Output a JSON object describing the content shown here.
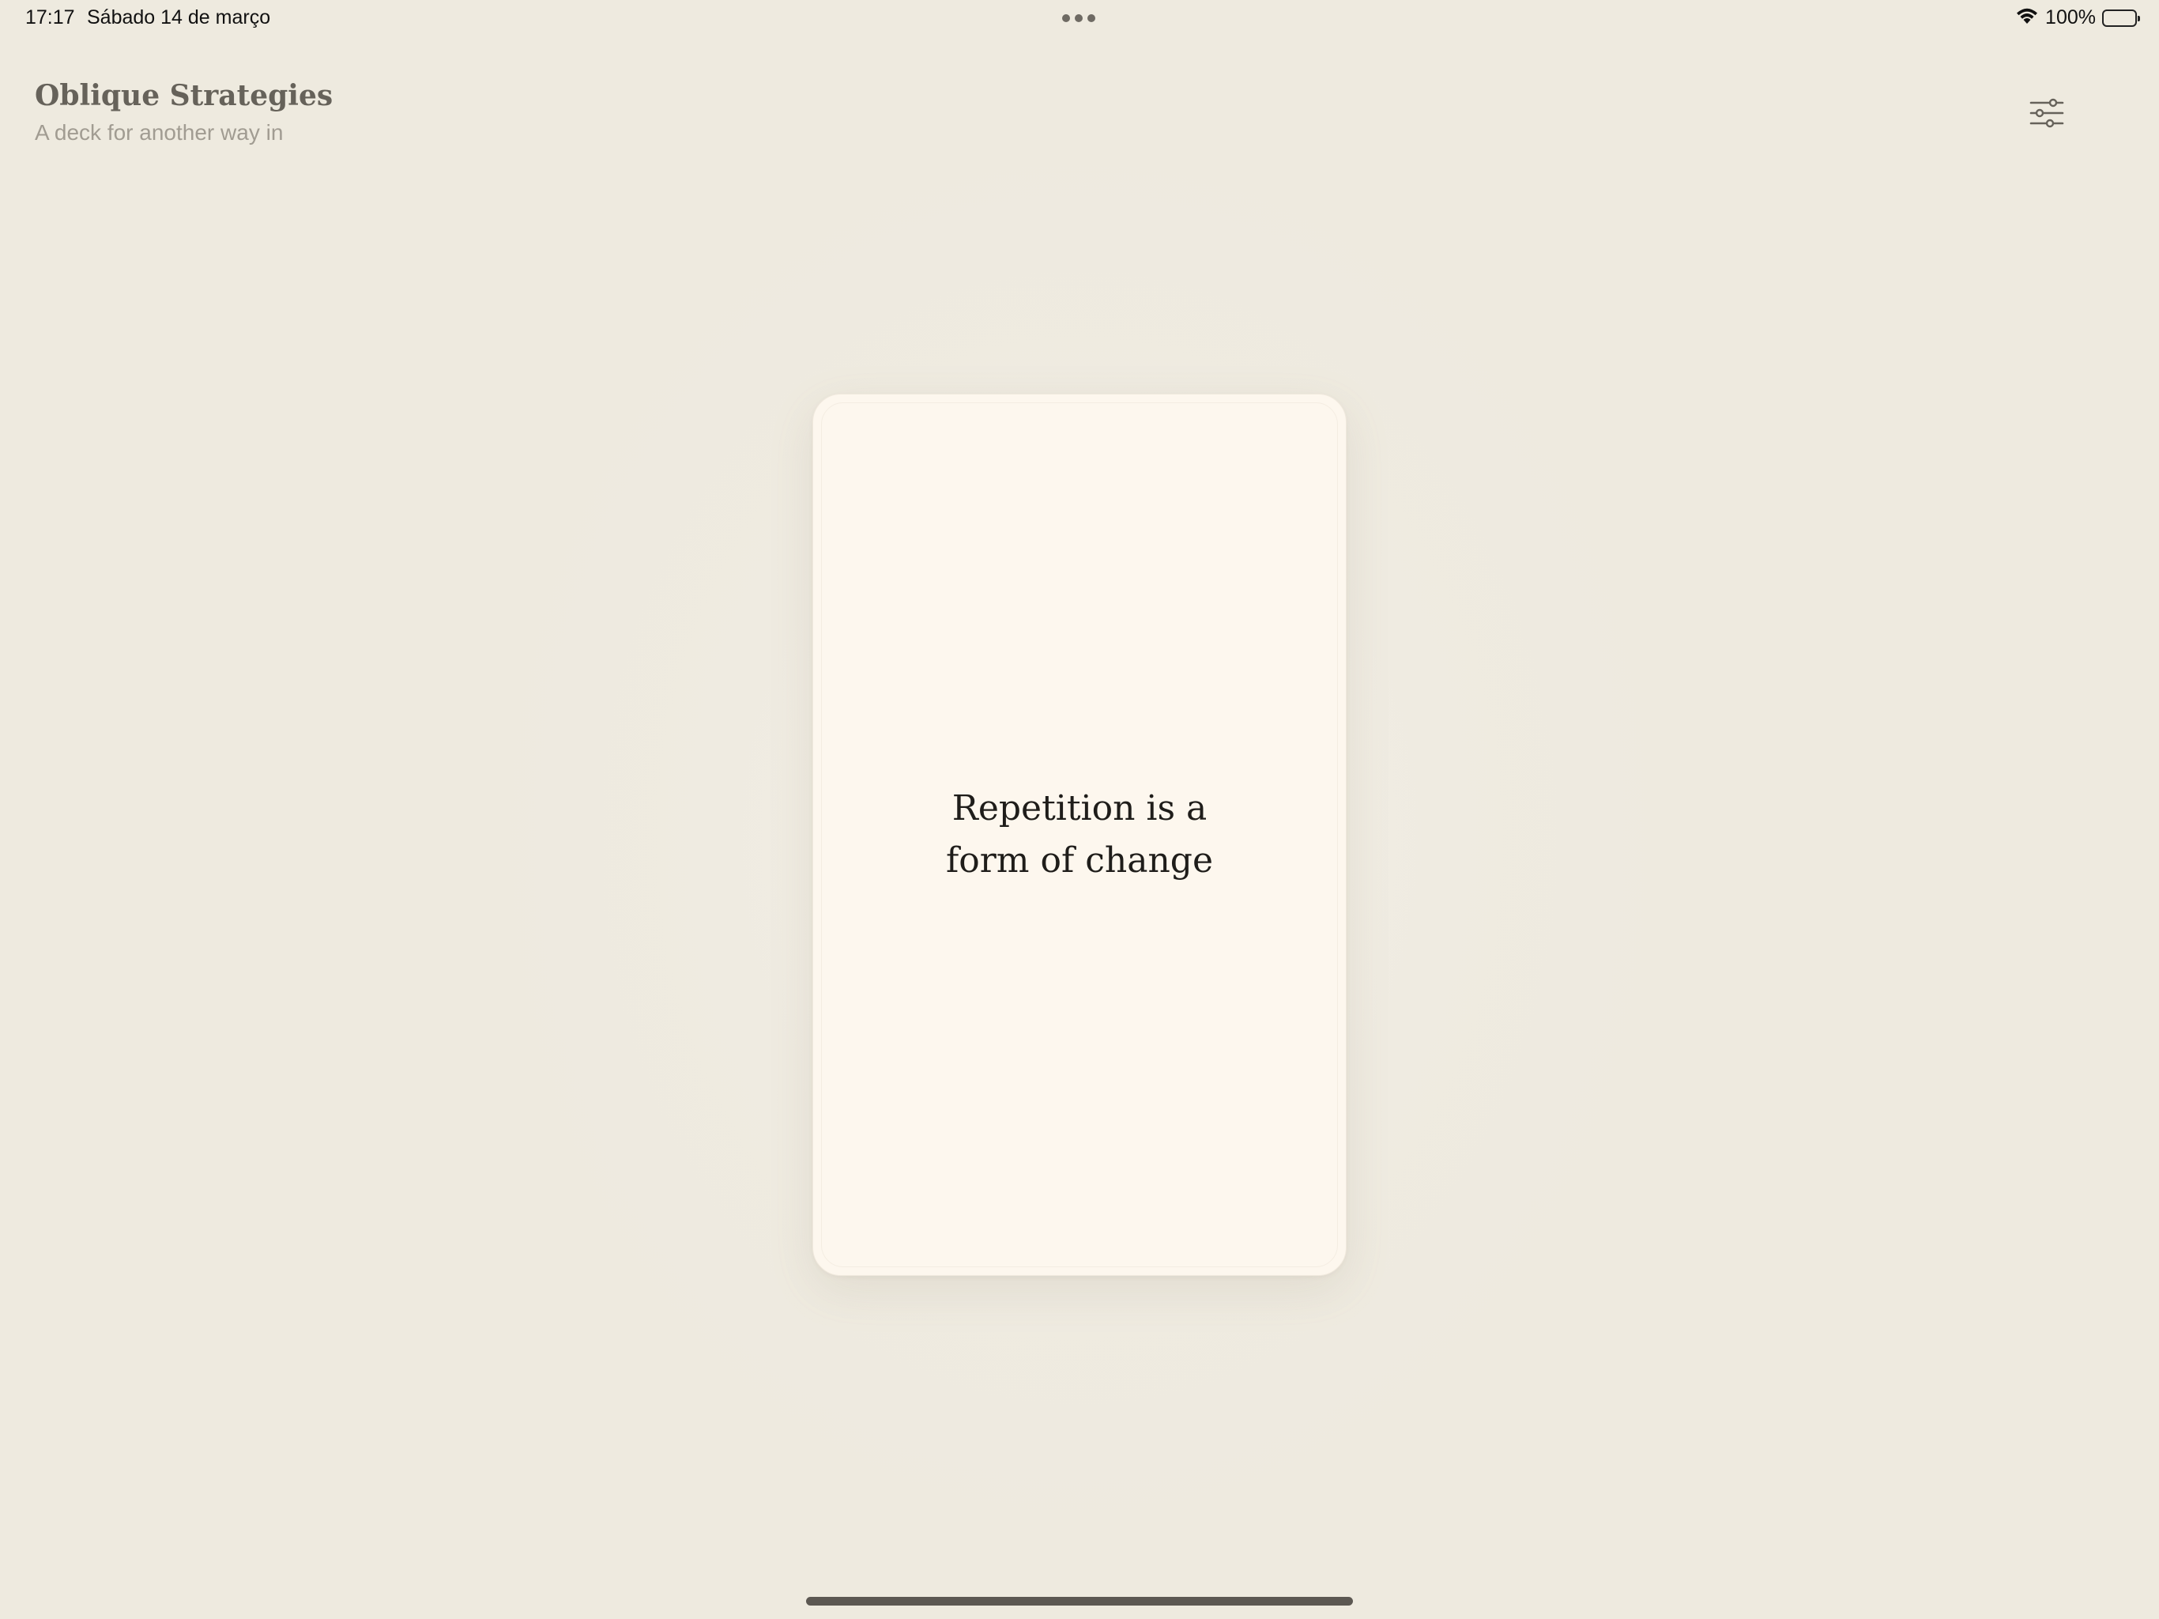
{
  "status_bar": {
    "time": "17:17",
    "date": "Sábado 14 de março",
    "battery_percent": "100%",
    "battery_level": 1.0,
    "wifi_icon": "wifi-icon",
    "battery_icon": "battery-icon"
  },
  "header": {
    "title": "Oblique Strategies",
    "subtitle": "A deck for another way in",
    "settings_icon": "sliders-icon"
  },
  "card": {
    "text": "Repetition is a form of change"
  },
  "colors": {
    "background": "#efebe0",
    "card_background": "#fdf7ee",
    "title": "#66625a",
    "subtitle": "#a19c92",
    "card_text": "#1f1d1a"
  }
}
